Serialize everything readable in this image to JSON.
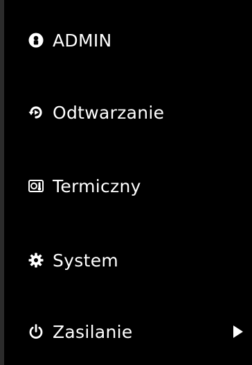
{
  "menu": {
    "items": [
      {
        "label": "ADMIN",
        "icon": "user-circle-icon"
      },
      {
        "label": "Odtwarzanie",
        "icon": "playback-icon"
      },
      {
        "label": "Termiczny",
        "icon": "thermal-icon"
      },
      {
        "label": "System",
        "icon": "gear-icon"
      },
      {
        "label": "Zasilanie",
        "icon": "power-icon",
        "submenu_indicator": "chevron-right-icon"
      }
    ],
    "colors": {
      "background": "#000000",
      "text": "#ffffff",
      "border": "#2b2b2b"
    }
  }
}
